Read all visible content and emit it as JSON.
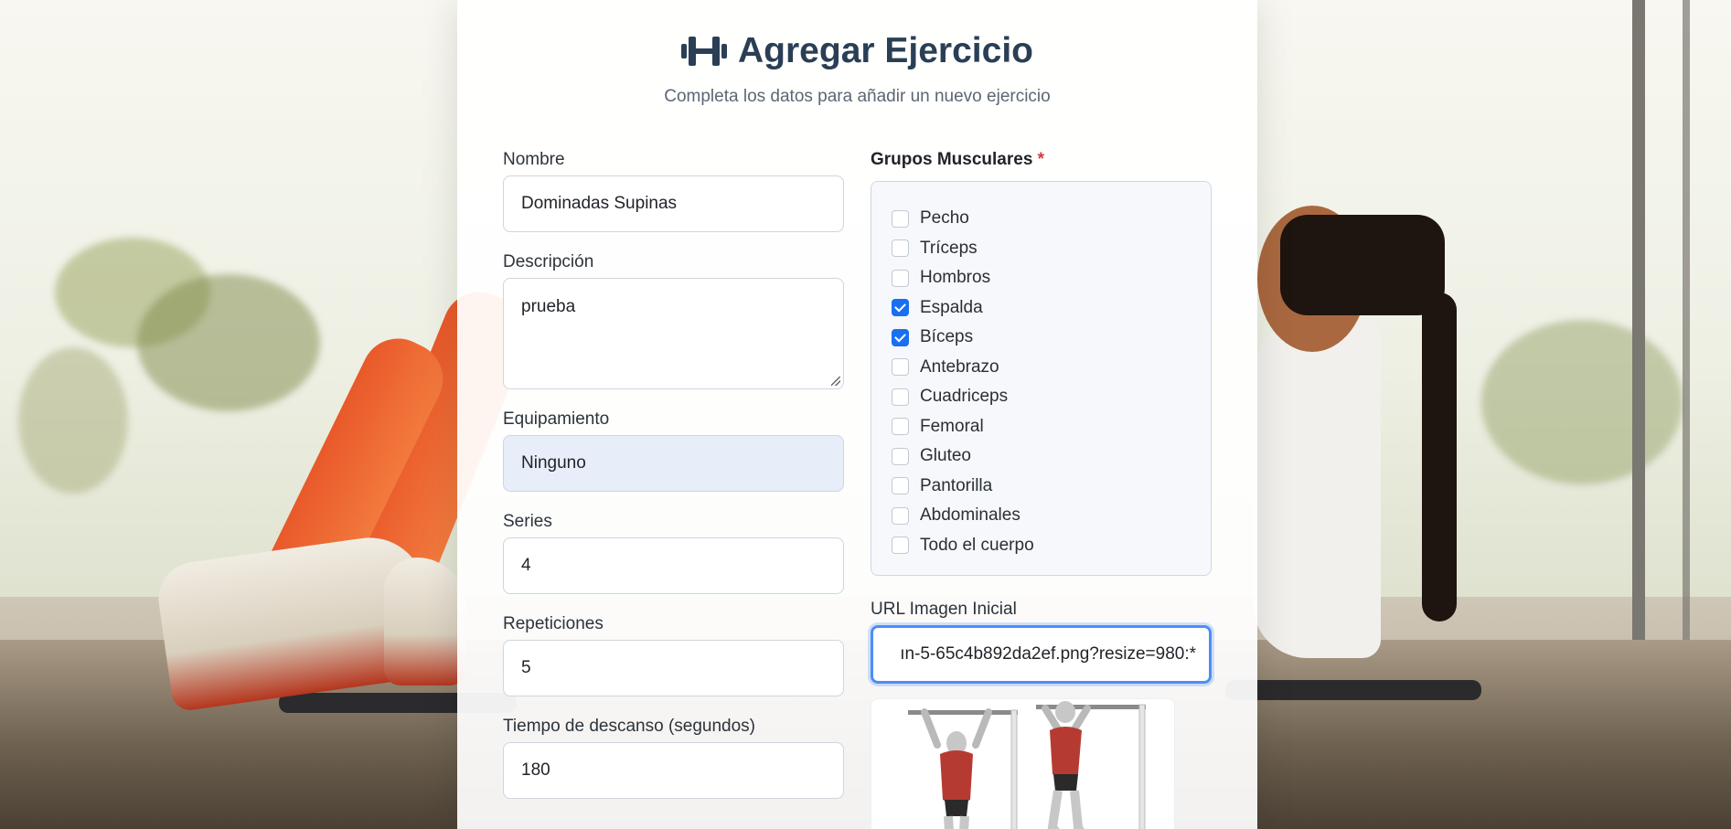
{
  "page": {
    "title": "Agregar Ejercicio",
    "subtitle": "Completa los datos para añadir un nuevo ejercicio",
    "title_icon": "dumbbell-icon"
  },
  "form": {
    "nombre": {
      "label": "Nombre",
      "value": "Dominadas Supinas"
    },
    "descripcion": {
      "label": "Descripción",
      "value": "prueba"
    },
    "equipamiento": {
      "label": "Equipamiento",
      "value": "Ninguno"
    },
    "series": {
      "label": "Series",
      "value": "4"
    },
    "repeticiones": {
      "label": "Repeticiones",
      "value": "5"
    },
    "descanso": {
      "label": "Tiempo de descanso (segundos)",
      "value": "180"
    },
    "grupos": {
      "label": "Grupos Musculares",
      "required_mark": "*",
      "options": [
        {
          "label": "Pecho",
          "checked": false
        },
        {
          "label": "Tríceps",
          "checked": false
        },
        {
          "label": "Hombros",
          "checked": false
        },
        {
          "label": "Espalda",
          "checked": true
        },
        {
          "label": "Bíceps",
          "checked": true
        },
        {
          "label": "Antebrazo",
          "checked": false
        },
        {
          "label": "Cuadriceps",
          "checked": false
        },
        {
          "label": "Femoral",
          "checked": false
        },
        {
          "label": "Gluteo",
          "checked": false
        },
        {
          "label": "Pantorilla",
          "checked": false
        },
        {
          "label": "Abdominales",
          "checked": false
        },
        {
          "label": "Todo el cuerpo",
          "checked": false
        }
      ]
    },
    "url_imagen": {
      "label": "URL Imagen Inicial",
      "value": "ın-5-65c4b892da2ef.png?resize=980:*"
    }
  },
  "colors": {
    "accent": "#1a6ff0",
    "title": "#2a3f55",
    "required": "#d63a3a"
  }
}
